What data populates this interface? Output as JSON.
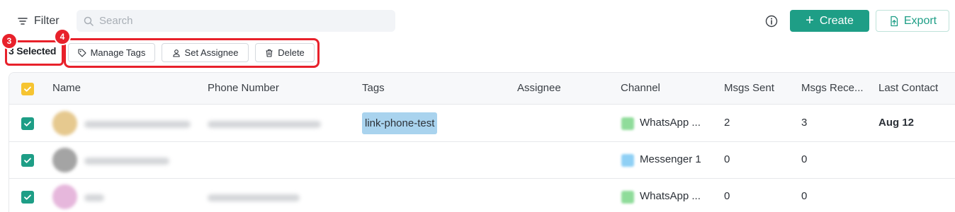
{
  "toolbar": {
    "filter_label": "Filter",
    "search_placeholder": "Search",
    "create_label": "Create",
    "export_label": "Export"
  },
  "selection": {
    "count_label": "3 Selected",
    "badge_selected": "3",
    "badge_actions": "4",
    "actions": {
      "manage_tags": "Manage Tags",
      "set_assignee": "Set Assignee",
      "delete": "Delete"
    }
  },
  "table": {
    "columns": [
      "Name",
      "Phone Number",
      "Tags",
      "Assignee",
      "Channel",
      "Msgs Sent",
      "Msgs Rece...",
      "Last Contact"
    ],
    "rows": [
      {
        "tag": "link-phone-test",
        "channel": "WhatsApp ...",
        "msgs_sent": "2",
        "msgs_received": "3",
        "last_contact": "Aug 12"
      },
      {
        "tag": "",
        "channel": "Messenger 1",
        "msgs_sent": "0",
        "msgs_received": "0",
        "last_contact": ""
      },
      {
        "tag": "",
        "channel": "WhatsApp ...",
        "msgs_sent": "0",
        "msgs_received": "0",
        "last_contact": ""
      }
    ]
  },
  "colors": {
    "accent": "#1e9e86",
    "highlight": "#e8212b",
    "tag_bg": "#a9d3ee",
    "header_checkbox": "#f6c431",
    "whatsapp_icon": "#8fdc9a",
    "messenger_icon": "#8fd0f5"
  },
  "icons": {
    "filter": "filter-icon",
    "search": "search-icon",
    "info": "info-icon",
    "create": "plus-icon",
    "export": "export-file-icon",
    "tags": "tag-icon",
    "assignee": "user-icon",
    "delete": "trash-icon",
    "checkbox": "check-icon"
  }
}
